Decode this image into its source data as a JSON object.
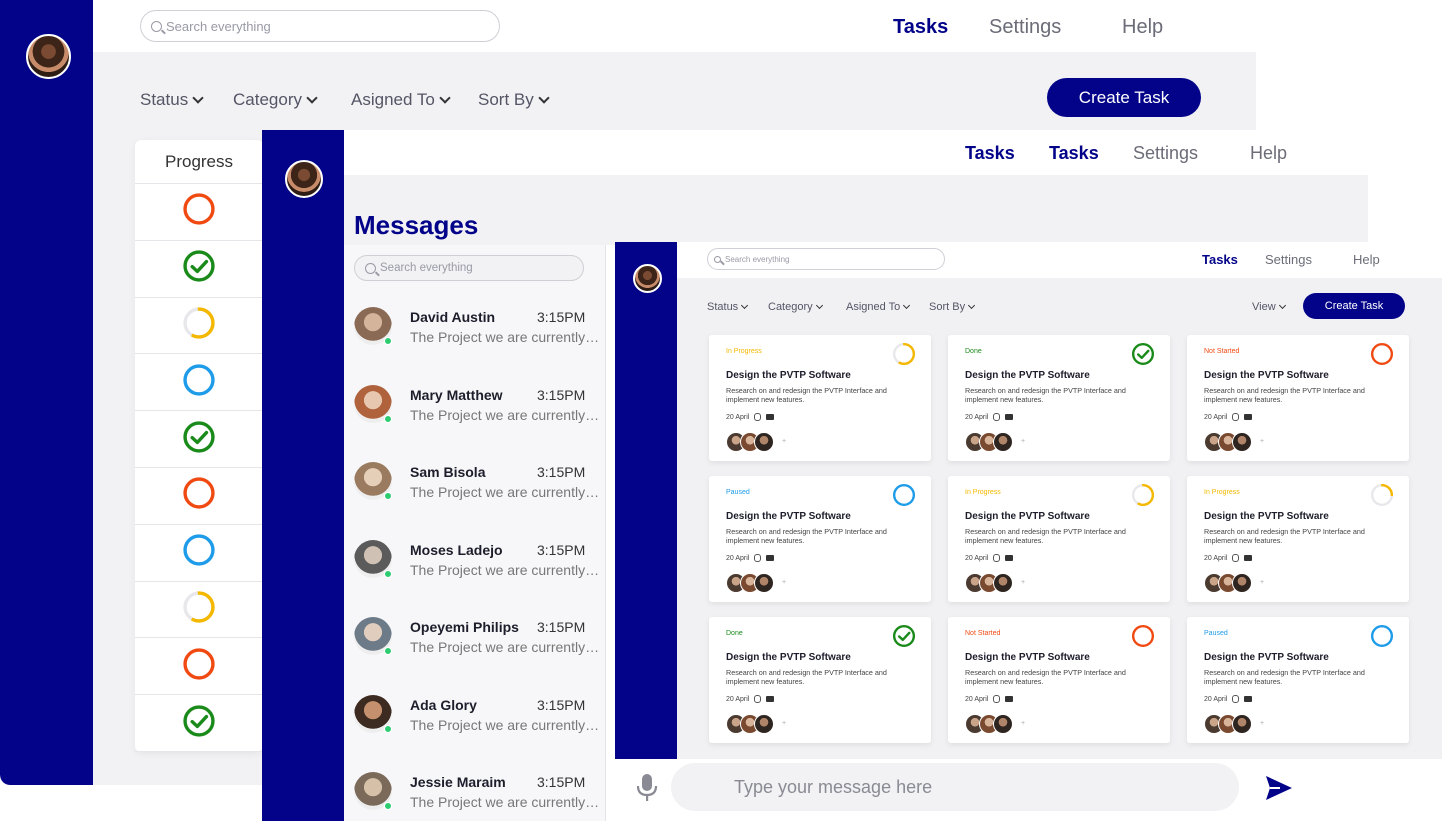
{
  "colors": {
    "brand": "#03038a",
    "not_started": "#f04a12",
    "done": "#1a8a1a",
    "in_progress": "#f5b800",
    "paused": "#1e9be9"
  },
  "back_window": {
    "search": {
      "placeholder": "Search everything"
    },
    "nav": [
      {
        "label": "Tasks",
        "active": true
      },
      {
        "label": "Settings"
      },
      {
        "label": "Help"
      }
    ],
    "filters": [
      "Status",
      "Category",
      "Asigned To",
      "Sort By"
    ],
    "create_button": "Create Task",
    "progress": {
      "header": "Progress",
      "items": [
        "not_started",
        "done",
        "in_progress",
        "paused",
        "done",
        "not_started",
        "paused",
        "in_progress",
        "not_started",
        "done"
      ]
    }
  },
  "messages_window": {
    "nav": [
      {
        "label": "Tasks",
        "active": true
      },
      {
        "label": "Tasks",
        "active": true
      },
      {
        "label": "Settings"
      },
      {
        "label": "Help"
      }
    ],
    "title": "Messages",
    "search": {
      "placeholder": "Search everything"
    },
    "messages": [
      {
        "name": "David Austin",
        "time": "3:15PM",
        "preview": "The Project we are currently working on"
      },
      {
        "name": "Mary Matthew",
        "time": "3:15PM",
        "preview": "The Project we are currently working on"
      },
      {
        "name": "Sam Bisola",
        "time": "3:15PM",
        "preview": "The Project we are currently working on"
      },
      {
        "name": "Moses Ladejo",
        "time": "3:15PM",
        "preview": "The Project we are currently working on"
      },
      {
        "name": "Opeyemi Philips",
        "time": "3:15PM",
        "preview": "The Project we are currently working on"
      },
      {
        "name": "Ada Glory",
        "time": "3:15PM",
        "preview": "The Project we are currently working on"
      },
      {
        "name": "Jessie Maraim",
        "time": "3:15PM",
        "preview": "The Project we are currently working on"
      }
    ],
    "composer": {
      "placeholder": "Type your message here"
    }
  },
  "tasks_window": {
    "search": {
      "placeholder": "Search everything"
    },
    "nav": [
      {
        "label": "Tasks",
        "active": true
      },
      {
        "label": "Settings"
      },
      {
        "label": "Help"
      }
    ],
    "filters": [
      "Status",
      "Category",
      "Asigned To",
      "Sort By"
    ],
    "view_label": "View",
    "create_button": "Create Task",
    "cards": [
      {
        "status": "In Progress",
        "state": "in_progress",
        "title": "Design the PVTP Software",
        "desc": "Research on and redesign the PVTP Interface and implement new features.",
        "date": "20 April"
      },
      {
        "status": "Done",
        "state": "done",
        "title": "Design the PVTP Software",
        "desc": "Research on and redesign the PVTP Interface and implement new features.",
        "date": "20 April"
      },
      {
        "status": "Not Started",
        "state": "not_started",
        "title": "Design the PVTP Software",
        "desc": "Research on and redesign the PVTP Interface and implement new features.",
        "date": "20 April"
      },
      {
        "status": "Paused",
        "state": "paused",
        "title": "Design the PVTP Software",
        "desc": "Research on and redesign the PVTP Interface and implement new features.",
        "date": "20 April"
      },
      {
        "status": "In Progress",
        "state": "in_progress",
        "title": "Design the PVTP Software",
        "desc": "Research on and redesign the PVTP Interface and implement new features.",
        "date": "20 April"
      },
      {
        "status": "In Progress",
        "state": "in_progress_quarter",
        "title": "Design the PVTP Software",
        "desc": "Research on and redesign the PVTP Interface and implement new features.",
        "date": "20 April"
      },
      {
        "status": "Done",
        "state": "done",
        "title": "Design the PVTP Software",
        "desc": "Research on and redesign the PVTP Interface and implement new features.",
        "date": "20 April"
      },
      {
        "status": "Not Started",
        "state": "not_started",
        "title": "Design the PVTP Software",
        "desc": "Research on and redesign the PVTP Interface and implement new features.",
        "date": "20 April"
      },
      {
        "status": "Paused",
        "state": "paused",
        "title": "Design the PVTP Software",
        "desc": "Research on and redesign the PVTP Interface and implement new features.",
        "date": "20 April"
      }
    ]
  }
}
